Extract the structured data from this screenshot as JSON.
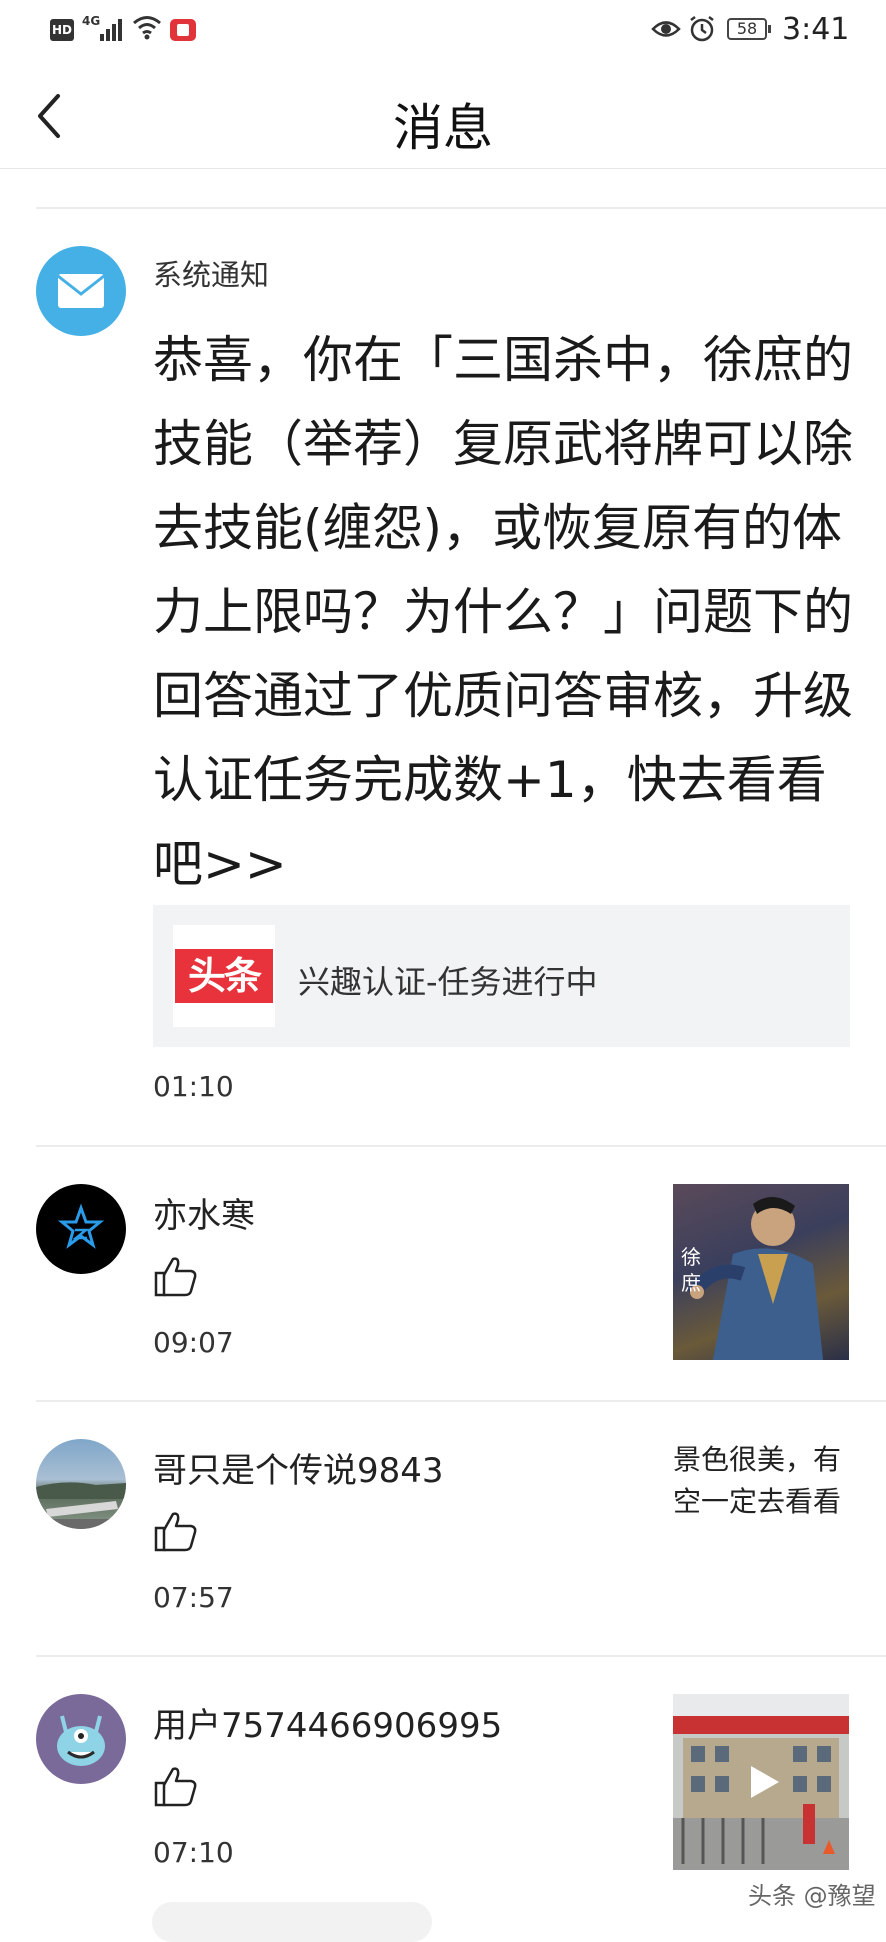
{
  "status_bar": {
    "network_badge": "HD",
    "network_type": "4G",
    "battery": "58",
    "time": "3:41"
  },
  "header": {
    "title": "消息",
    "back_icon": "chevron-left-icon"
  },
  "system_notice": {
    "label": "系统通知",
    "icon": "mail-icon",
    "message": "恭喜，你在「三国杀中，徐庶的技能（举荐）复原武将牌可以除去技能(缠怨)，或恢复原有的体力上限吗？为什么？」问题下的回答通过了优质问答审核，升级认证任务完成数+1，快去看看吧>>",
    "card": {
      "logo_text": "头条",
      "text": "兴趣认证-任务进行中"
    },
    "time": "01:10"
  },
  "notifications": [
    {
      "name": "亦水寒",
      "action_icon": "thumbs-up-icon",
      "time": "09:07",
      "thumb_caption": "徐庶"
    },
    {
      "name": "哥只是个传说9843",
      "action_icon": "thumbs-up-icon",
      "time": "07:57",
      "reply_text": "景色很美，有空一定去看看"
    },
    {
      "name": "用户7574466906995",
      "action_icon": "thumbs-up-icon",
      "time": "07:10",
      "thumb_type": "video"
    }
  ],
  "watermark": "头条 @豫望",
  "colors": {
    "mail_avatar": "#45b0e6",
    "toutiao_red": "#e8323c",
    "card_bg": "#f2f3f5",
    "divider": "#ececec"
  }
}
